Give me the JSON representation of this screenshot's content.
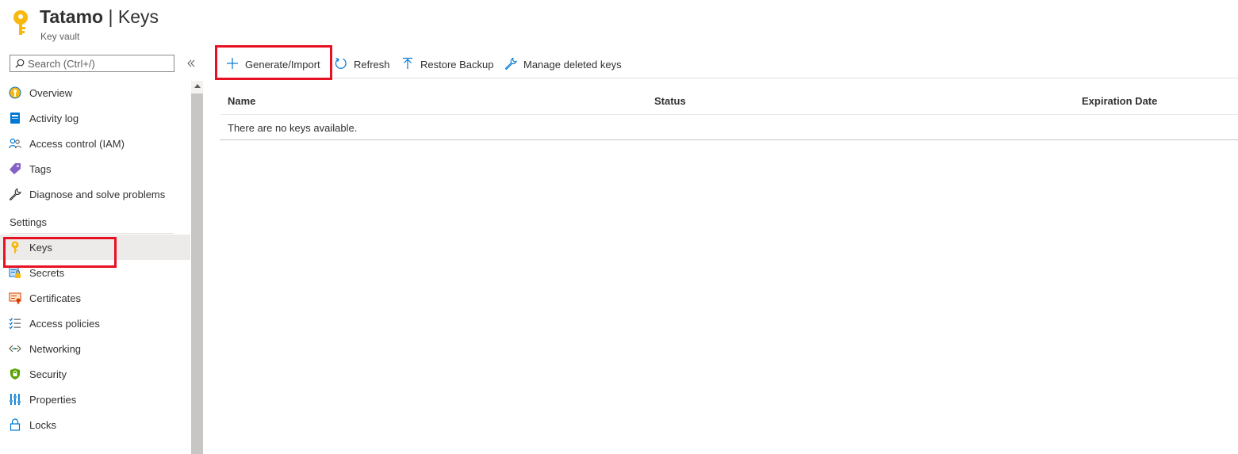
{
  "header": {
    "resource_name": "Tatamo",
    "separator": " | ",
    "page_name": "Keys",
    "subtitle": "Key vault",
    "icon": "key-icon"
  },
  "sidebar": {
    "search": {
      "placeholder": "Search (Ctrl+/)",
      "value": "",
      "icon": "search-icon"
    },
    "collapse_icon": "double-chevron-left-icon",
    "items": [
      {
        "label": "Overview",
        "icon": "overview-icon"
      },
      {
        "label": "Activity log",
        "icon": "activity-log-icon"
      },
      {
        "label": "Access control (IAM)",
        "icon": "users-icon"
      },
      {
        "label": "Tags",
        "icon": "tag-icon"
      },
      {
        "label": "Diagnose and solve problems",
        "icon": "wrench-icon"
      }
    ],
    "settings_section": {
      "label": "Settings",
      "items": [
        {
          "label": "Keys",
          "icon": "key-icon",
          "selected": true
        },
        {
          "label": "Secrets",
          "icon": "secret-icon"
        },
        {
          "label": "Certificates",
          "icon": "certificate-icon"
        },
        {
          "label": "Access policies",
          "icon": "checklist-icon"
        },
        {
          "label": "Networking",
          "icon": "network-icon"
        },
        {
          "label": "Security",
          "icon": "shield-icon"
        },
        {
          "label": "Properties",
          "icon": "properties-icon"
        },
        {
          "label": "Locks",
          "icon": "lock-icon"
        }
      ]
    }
  },
  "toolbar": {
    "generate_import": "Generate/Import",
    "refresh": "Refresh",
    "restore_backup": "Restore Backup",
    "manage_deleted": "Manage deleted keys"
  },
  "table": {
    "columns": [
      "Name",
      "Status",
      "Expiration Date"
    ],
    "empty_message": "There are no keys available."
  },
  "colors": {
    "accent": "#0078d4",
    "key_yellow": "#f8b80d",
    "highlight": "#e81123",
    "selected_bg": "#edebe9"
  }
}
